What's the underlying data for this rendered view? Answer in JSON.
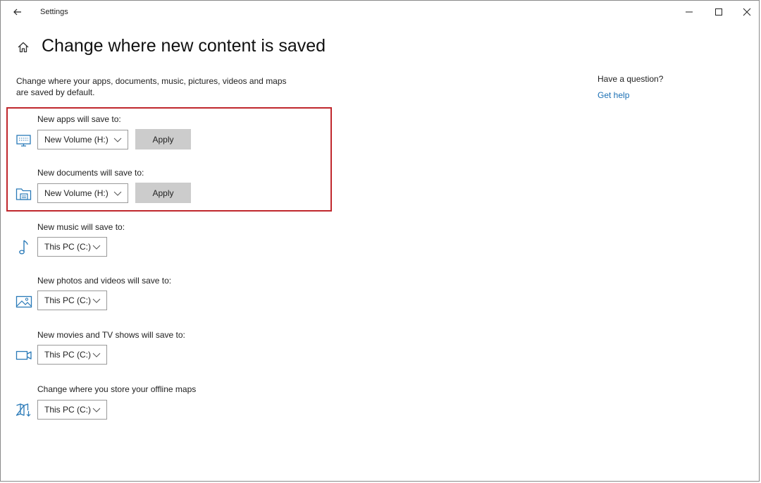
{
  "window": {
    "title": "Settings"
  },
  "header": {
    "title": "Change where new content is saved"
  },
  "description": "Change where your apps, documents, music, pictures, videos and maps are saved by default.",
  "settings": [
    {
      "label": "New apps will save to:",
      "value": "New Volume (H:)",
      "icon": "monitor-icon",
      "apply_label": "Apply"
    },
    {
      "label": "New documents will save to:",
      "value": "New Volume (H:)",
      "icon": "folder-documents-icon",
      "apply_label": "Apply"
    },
    {
      "label": "New music will save to:",
      "value": "This PC (C:)",
      "icon": "music-note-icon"
    },
    {
      "label": "New photos and videos will save to:",
      "value": "This PC (C:)",
      "icon": "picture-icon"
    },
    {
      "label": "New movies and TV shows will save to:",
      "value": "This PC (C:)",
      "icon": "video-camera-icon"
    },
    {
      "label": "Change where you store your offline maps",
      "value": "This PC (C:)",
      "icon": "map-download-icon"
    }
  ],
  "aside": {
    "question": "Have a question?",
    "help_link": "Get help"
  },
  "colors": {
    "accent": "#1a6fb4",
    "highlight": "#c0282d",
    "apply_button": "#cccccc"
  }
}
